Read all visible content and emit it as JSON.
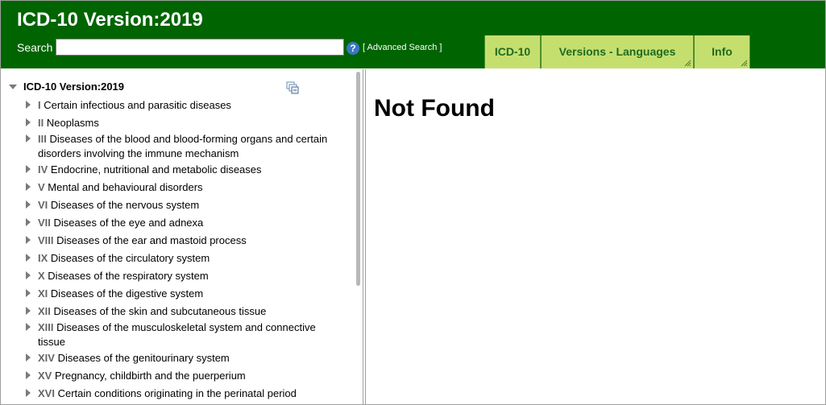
{
  "header": {
    "title": "ICD-10 Version:2019",
    "search_label": "Search",
    "search_value": "",
    "help_label": "?",
    "advanced_search_label": "[ Advanced Search ]",
    "bg_color": "#006400"
  },
  "tabs": [
    {
      "label": "ICD-10"
    },
    {
      "label": "Versions - Languages"
    },
    {
      "label": "Info"
    }
  ],
  "tree": {
    "root_label": "ICD-10 Version:2019",
    "chapters": [
      {
        "num": "I",
        "title": "Certain infectious and parasitic diseases"
      },
      {
        "num": "II",
        "title": "Neoplasms"
      },
      {
        "num": "III",
        "title": "Diseases of the blood and blood-forming organs and certain disorders involving the immune mechanism"
      },
      {
        "num": "IV",
        "title": "Endocrine, nutritional and metabolic diseases"
      },
      {
        "num": "V",
        "title": "Mental and behavioural disorders"
      },
      {
        "num": "VI",
        "title": "Diseases of the nervous system"
      },
      {
        "num": "VII",
        "title": "Diseases of the eye and adnexa"
      },
      {
        "num": "VIII",
        "title": "Diseases of the ear and mastoid process"
      },
      {
        "num": "IX",
        "title": "Diseases of the circulatory system"
      },
      {
        "num": "X",
        "title": "Diseases of the respiratory system"
      },
      {
        "num": "XI",
        "title": "Diseases of the digestive system"
      },
      {
        "num": "XII",
        "title": "Diseases of the skin and subcutaneous tissue"
      },
      {
        "num": "XIII",
        "title": "Diseases of the musculoskeletal system and connective tissue"
      },
      {
        "num": "XIV",
        "title": "Diseases of the genitourinary system"
      },
      {
        "num": "XV",
        "title": "Pregnancy, childbirth and the puerperium"
      },
      {
        "num": "XVI",
        "title": "Certain conditions originating in the perinatal period"
      }
    ]
  },
  "main": {
    "message": "Not Found"
  }
}
